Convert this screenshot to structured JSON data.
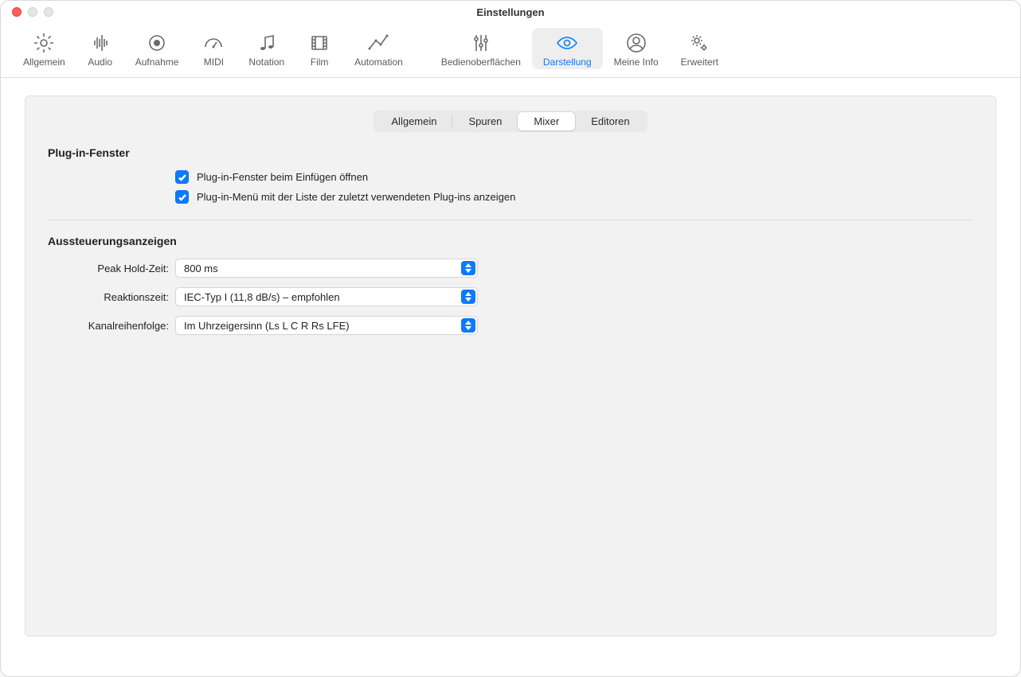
{
  "window": {
    "title": "Einstellungen"
  },
  "toolbar": {
    "items": [
      {
        "id": "allgemein",
        "label": "Allgemein"
      },
      {
        "id": "audio",
        "label": "Audio"
      },
      {
        "id": "aufnahme",
        "label": "Aufnahme"
      },
      {
        "id": "midi",
        "label": "MIDI"
      },
      {
        "id": "notation",
        "label": "Notation"
      },
      {
        "id": "film",
        "label": "Film"
      },
      {
        "id": "automation",
        "label": "Automation"
      },
      {
        "id": "bedienoberflaechen",
        "label": "Bedienoberflächen"
      },
      {
        "id": "darstellung",
        "label": "Darstellung",
        "active": true
      },
      {
        "id": "meineinfo",
        "label": "Meine Info"
      },
      {
        "id": "erweitert",
        "label": "Erweitert"
      }
    ]
  },
  "tabs": {
    "items": [
      {
        "id": "allgemein",
        "label": "Allgemein"
      },
      {
        "id": "spuren",
        "label": "Spuren"
      },
      {
        "id": "mixer",
        "label": "Mixer",
        "active": true
      },
      {
        "id": "editoren",
        "label": "Editoren"
      }
    ]
  },
  "sections": {
    "plugin": {
      "title": "Plug-in-Fenster",
      "check1": "Plug-in-Fenster beim Einfügen öffnen",
      "check2": "Plug-in-Menü mit der Liste der zuletzt verwendeten Plug-ins anzeigen"
    },
    "meters": {
      "title": "Aussteuerungsanzeigen",
      "peak_label": "Peak Hold-Zeit:",
      "peak_value": "800 ms",
      "reaction_label": "Reaktionszeit:",
      "reaction_value": "IEC-Typ I (11,8 dB/s) – empfohlen",
      "channel_label": "Kanalreihenfolge:",
      "channel_value": "Im Uhrzeigersinn (Ls L C R Rs LFE)"
    }
  }
}
